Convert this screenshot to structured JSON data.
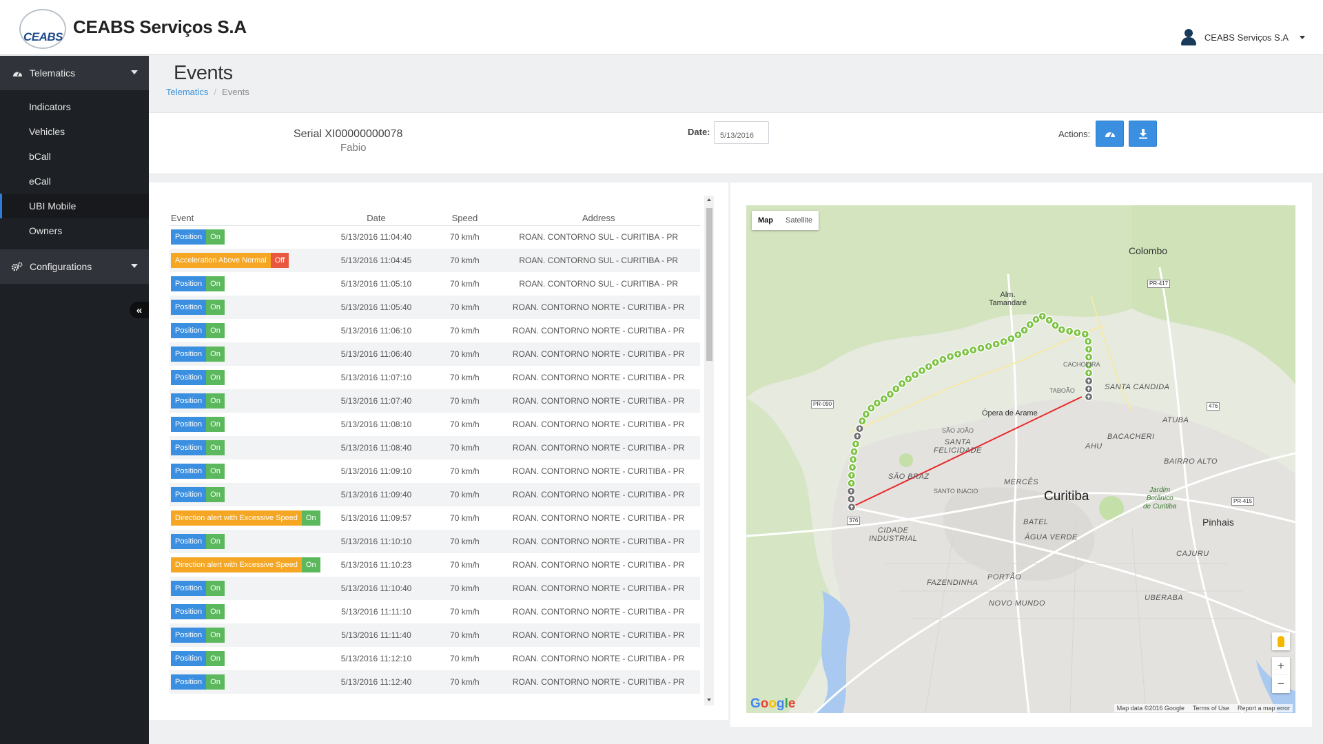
{
  "header": {
    "logo_text": "CEABS",
    "company_name": "CEABS Serviços S.A",
    "user_name": "CEABS Serviços S.A"
  },
  "sidebar": {
    "telematics": {
      "label": "Telematics"
    },
    "items": [
      {
        "label": "Indicators"
      },
      {
        "label": "Vehicles"
      },
      {
        "label": "bCall"
      },
      {
        "label": "eCall"
      },
      {
        "label": "UBI Mobile"
      },
      {
        "label": "Owners"
      }
    ],
    "configurations": {
      "label": "Configurations"
    },
    "collapse_glyph": "«"
  },
  "page": {
    "title": "Events",
    "breadcrumb": {
      "parent": "Telematics",
      "separator": "/",
      "current": "Events"
    }
  },
  "info": {
    "serial": "Serial XI00000000078",
    "driver": "Fabio",
    "date_label": "Date:",
    "date_value": "5/13/2016",
    "actions_label": "Actions:"
  },
  "table": {
    "columns": {
      "event": "Event",
      "date": "Date",
      "speed": "Speed",
      "address": "Address"
    },
    "rows": [
      {
        "event": "Position",
        "event_color": "blue",
        "state": "On",
        "state_color": "green",
        "date": "5/13/2016 11:04:40",
        "speed": "70 km/h",
        "address": "ROAN. CONTORNO SUL - CURITIBA - PR"
      },
      {
        "event": "Acceleration Above Normal",
        "event_color": "orange",
        "state": "Off",
        "state_color": "red",
        "date": "5/13/2016 11:04:45",
        "speed": "70 km/h",
        "address": "ROAN. CONTORNO SUL - CURITIBA - PR"
      },
      {
        "event": "Position",
        "event_color": "blue",
        "state": "On",
        "state_color": "green",
        "date": "5/13/2016 11:05:10",
        "speed": "70 km/h",
        "address": "ROAN. CONTORNO SUL - CURITIBA - PR"
      },
      {
        "event": "Position",
        "event_color": "blue",
        "state": "On",
        "state_color": "green",
        "date": "5/13/2016 11:05:40",
        "speed": "70 km/h",
        "address": "ROAN. CONTORNO NORTE - CURITIBA - PR"
      },
      {
        "event": "Position",
        "event_color": "blue",
        "state": "On",
        "state_color": "green",
        "date": "5/13/2016 11:06:10",
        "speed": "70 km/h",
        "address": "ROAN. CONTORNO NORTE - CURITIBA - PR"
      },
      {
        "event": "Position",
        "event_color": "blue",
        "state": "On",
        "state_color": "green",
        "date": "5/13/2016 11:06:40",
        "speed": "70 km/h",
        "address": "ROAN. CONTORNO NORTE - CURITIBA - PR"
      },
      {
        "event": "Position",
        "event_color": "blue",
        "state": "On",
        "state_color": "green",
        "date": "5/13/2016 11:07:10",
        "speed": "70 km/h",
        "address": "ROAN. CONTORNO NORTE - CURITIBA - PR"
      },
      {
        "event": "Position",
        "event_color": "blue",
        "state": "On",
        "state_color": "green",
        "date": "5/13/2016 11:07:40",
        "speed": "70 km/h",
        "address": "ROAN. CONTORNO NORTE - CURITIBA - PR"
      },
      {
        "event": "Position",
        "event_color": "blue",
        "state": "On",
        "state_color": "green",
        "date": "5/13/2016 11:08:10",
        "speed": "70 km/h",
        "address": "ROAN. CONTORNO NORTE - CURITIBA - PR"
      },
      {
        "event": "Position",
        "event_color": "blue",
        "state": "On",
        "state_color": "green",
        "date": "5/13/2016 11:08:40",
        "speed": "70 km/h",
        "address": "ROAN. CONTORNO NORTE - CURITIBA - PR"
      },
      {
        "event": "Position",
        "event_color": "blue",
        "state": "On",
        "state_color": "green",
        "date": "5/13/2016 11:09:10",
        "speed": "70 km/h",
        "address": "ROAN. CONTORNO NORTE - CURITIBA - PR"
      },
      {
        "event": "Position",
        "event_color": "blue",
        "state": "On",
        "state_color": "green",
        "date": "5/13/2016 11:09:40",
        "speed": "70 km/h",
        "address": "ROAN. CONTORNO NORTE - CURITIBA - PR"
      },
      {
        "event": "Direction alert with Excessive Speed",
        "event_color": "orange",
        "state": "On",
        "state_color": "green",
        "date": "5/13/2016 11:09:57",
        "speed": "70 km/h",
        "address": "ROAN. CONTORNO NORTE - CURITIBA - PR"
      },
      {
        "event": "Position",
        "event_color": "blue",
        "state": "On",
        "state_color": "green",
        "date": "5/13/2016 11:10:10",
        "speed": "70 km/h",
        "address": "ROAN. CONTORNO NORTE - CURITIBA - PR"
      },
      {
        "event": "Direction alert with Excessive Speed",
        "event_color": "orange",
        "state": "On",
        "state_color": "green",
        "date": "5/13/2016 11:10:23",
        "speed": "70 km/h",
        "address": "ROAN. CONTORNO NORTE - CURITIBA - PR"
      },
      {
        "event": "Position",
        "event_color": "blue",
        "state": "On",
        "state_color": "green",
        "date": "5/13/2016 11:10:40",
        "speed": "70 km/h",
        "address": "ROAN. CONTORNO NORTE - CURITIBA - PR"
      },
      {
        "event": "Position",
        "event_color": "blue",
        "state": "On",
        "state_color": "green",
        "date": "5/13/2016 11:11:10",
        "speed": "70 km/h",
        "address": "ROAN. CONTORNO NORTE - CURITIBA - PR"
      },
      {
        "event": "Position",
        "event_color": "blue",
        "state": "On",
        "state_color": "green",
        "date": "5/13/2016 11:11:40",
        "speed": "70 km/h",
        "address": "ROAN. CONTORNO NORTE - CURITIBA - PR"
      },
      {
        "event": "Position",
        "event_color": "blue",
        "state": "On",
        "state_color": "green",
        "date": "5/13/2016 11:12:10",
        "speed": "70 km/h",
        "address": "ROAN. CONTORNO NORTE - CURITIBA - PR"
      },
      {
        "event": "Position",
        "event_color": "blue",
        "state": "On",
        "state_color": "green",
        "date": "5/13/2016 11:12:40",
        "speed": "70 km/h",
        "address": "ROAN. CONTORNO NORTE - CURITIBA - PR"
      }
    ]
  },
  "map": {
    "toggle": {
      "map": "Map",
      "satellite": "Satellite"
    },
    "zoom_in": "+",
    "zoom_out": "−",
    "google": "Google",
    "footer": {
      "data": "Map data ©2016 Google",
      "terms": "Terms of Use",
      "report": "Report a map error"
    },
    "labels": {
      "colombo": "Colombo",
      "alm_tamandare": "Alm.\nTamandaré",
      "curitiba": "Curitiba",
      "opera": "Ópera de Arame",
      "santa_candida": "SANTA CANDIDA",
      "atuba": "ATUBA",
      "bacacheri": "BACACHERI",
      "bairro_alto": "BAIRRO ALTO",
      "santa_felicidade": "SANTA\nFELICIDADE",
      "ahu": "AHU",
      "sao_braz": "SÃO BRAZ",
      "merces": "MERCÊS",
      "jardim_botanico": "Jardim\nBotânico\nde Curitiba",
      "pinhais": "Pinhais",
      "batel": "BATEL",
      "agua_verde": "ÁGUA VERDE",
      "cidade_industrial": "CIDADE\nINDUSTRIAL",
      "cajuru": "CAJURU",
      "portao": "PORTÃO",
      "fazendinha": "FAZENDINHA",
      "novo_mundo": "NOVO MUNDO",
      "uberaba": "UBERABA",
      "cachoeira": "CACHOEIRA",
      "taboao": "TABOÃO",
      "sao_joao": "SÃO JOÃO",
      "santo_inacio": "SANTO INÁCIO",
      "pr417": "PR-417",
      "pr090": "PR-090",
      "pr415": "PR-415",
      "r476": "476",
      "r376": "376"
    },
    "colors": {
      "route": "#7cc242",
      "line": "#e8292b",
      "water": "#a9c9f0",
      "urban": "#e2e1de",
      "green": "#cfe3b5"
    }
  }
}
